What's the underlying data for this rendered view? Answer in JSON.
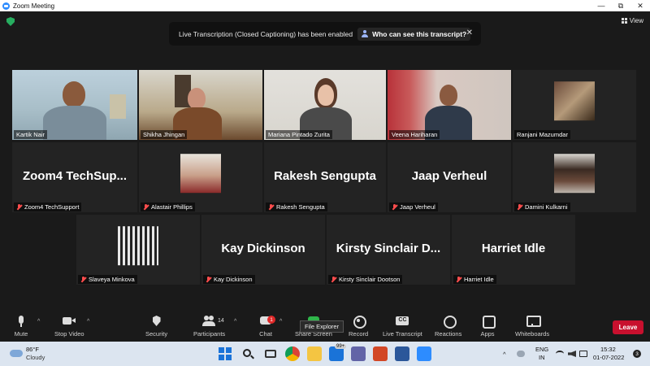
{
  "window": {
    "title": "Zoom Meeting",
    "controls": [
      "—",
      "⧉",
      "✕"
    ]
  },
  "header": {
    "view_label": "View"
  },
  "banner": {
    "text": "Live Transcription (Closed Captioning) has been enabled",
    "link": "Who can see this transcript?",
    "close": "✕"
  },
  "tiles": [
    {
      "name": "Kartik Nair",
      "kind": "video",
      "active": true
    },
    {
      "name": "Shikha Jhingan",
      "kind": "video"
    },
    {
      "name": "Mariana Pintado Zurita",
      "kind": "video"
    },
    {
      "name": "Veena Hariharan",
      "kind": "video"
    },
    {
      "name": "Ranjani Mazumdar",
      "kind": "avatar"
    },
    {
      "name": "Zoom4 TechSupport",
      "big": "Zoom4 TechSup...",
      "kind": "name",
      "muted": true
    },
    {
      "name": "Alastair Phillips",
      "kind": "avatar",
      "muted": true
    },
    {
      "name": "Rakesh Sengupta",
      "big": "Rakesh Sengupta",
      "kind": "name",
      "muted": true
    },
    {
      "name": "Jaap Verheul",
      "big": "Jaap Verheul",
      "kind": "name",
      "muted": true
    },
    {
      "name": "Damini Kulkarni",
      "kind": "avatar",
      "muted": true
    },
    {
      "name": "Slaveya Minkova",
      "kind": "avatar",
      "muted": true
    },
    {
      "name": "Kay Dickinson",
      "big": "Kay Dickinson",
      "kind": "name",
      "muted": true
    },
    {
      "name": "Kirsty Sinclair Dootson",
      "big": "Kirsty Sinclair D...",
      "kind": "name",
      "muted": true
    },
    {
      "name": "Harriet Idle",
      "big": "Harriet Idle",
      "kind": "name",
      "muted": true
    }
  ],
  "toolbar": {
    "mute": "Mute",
    "stop_video": "Stop Video",
    "security": "Security",
    "participants": "Participants",
    "participants_count": "14",
    "chat": "Chat",
    "chat_badge": "1",
    "share_screen": "Share Screen",
    "record": "Record",
    "live_transcript": "Live Transcript",
    "cc": "CC",
    "reactions": "Reactions",
    "apps": "Apps",
    "whiteboards": "Whiteboards",
    "leave": "Leave",
    "caret": "^"
  },
  "tooltip": "File Explorer",
  "taskbar": {
    "temperature": "86°F",
    "condition": "Cloudy",
    "badge": "99+",
    "lang": "ENG",
    "region": "IN",
    "time": "15:32",
    "date": "01-07-2022",
    "tray_caret": "^",
    "notif": "3"
  },
  "colors": {
    "leave": "#c8102e",
    "active_border": "#d9e67a",
    "muted": "#ff4d4d",
    "share": "#2fb54a"
  }
}
